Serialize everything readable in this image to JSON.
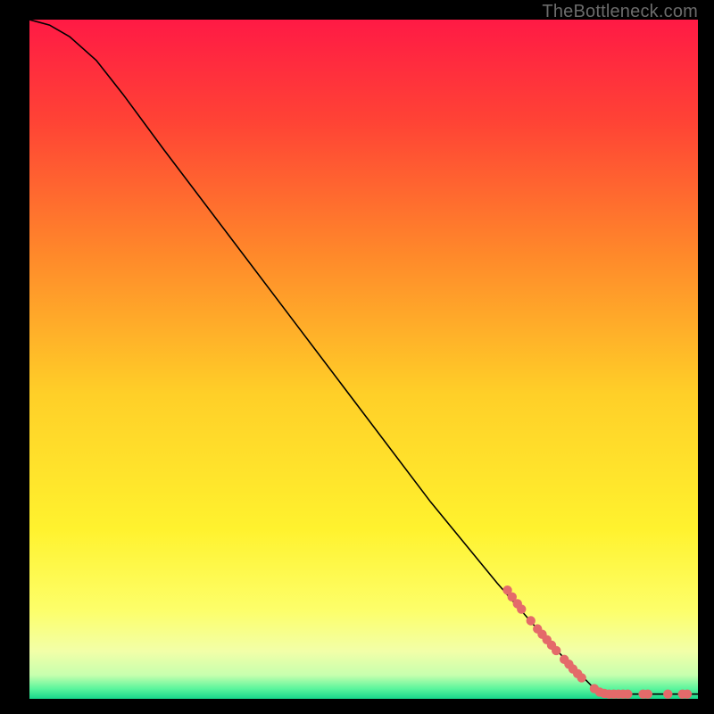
{
  "watermark": "TheBottleneck.com",
  "chart_data": {
    "type": "line",
    "title": "",
    "xlabel": "",
    "ylabel": "",
    "xlim": [
      0,
      100
    ],
    "ylim": [
      0,
      100
    ],
    "grid": false,
    "curve": [
      {
        "x": 0,
        "y": 100
      },
      {
        "x": 3,
        "y": 99.2
      },
      {
        "x": 6,
        "y": 97.5
      },
      {
        "x": 10,
        "y": 94
      },
      {
        "x": 14,
        "y": 89
      },
      {
        "x": 20,
        "y": 81
      },
      {
        "x": 30,
        "y": 68
      },
      {
        "x": 40,
        "y": 55
      },
      {
        "x": 50,
        "y": 42
      },
      {
        "x": 60,
        "y": 29
      },
      {
        "x": 70,
        "y": 17
      },
      {
        "x": 78,
        "y": 8
      },
      {
        "x": 84,
        "y": 2
      },
      {
        "x": 86,
        "y": 1
      },
      {
        "x": 88,
        "y": 0.7
      },
      {
        "x": 92,
        "y": 0.7
      },
      {
        "x": 96,
        "y": 0.7
      },
      {
        "x": 100,
        "y": 0.7
      }
    ],
    "markers": [
      {
        "x": 71.5,
        "y": 16.0
      },
      {
        "x": 72.2,
        "y": 15.0
      },
      {
        "x": 73.0,
        "y": 14.0
      },
      {
        "x": 73.6,
        "y": 13.2
      },
      {
        "x": 75.0,
        "y": 11.5
      },
      {
        "x": 76.0,
        "y": 10.3
      },
      {
        "x": 76.7,
        "y": 9.5
      },
      {
        "x": 77.4,
        "y": 8.7
      },
      {
        "x": 78.1,
        "y": 7.9
      },
      {
        "x": 78.8,
        "y": 7.1
      },
      {
        "x": 80.0,
        "y": 5.8
      },
      {
        "x": 80.7,
        "y": 5.1
      },
      {
        "x": 81.3,
        "y": 4.4
      },
      {
        "x": 82.0,
        "y": 3.7
      },
      {
        "x": 82.6,
        "y": 3.1
      },
      {
        "x": 84.5,
        "y": 1.5
      },
      {
        "x": 85.3,
        "y": 1.0
      },
      {
        "x": 86.0,
        "y": 0.8
      },
      {
        "x": 86.7,
        "y": 0.7
      },
      {
        "x": 87.4,
        "y": 0.7
      },
      {
        "x": 88.1,
        "y": 0.7
      },
      {
        "x": 88.8,
        "y": 0.7
      },
      {
        "x": 89.5,
        "y": 0.7
      },
      {
        "x": 91.8,
        "y": 0.7
      },
      {
        "x": 92.5,
        "y": 0.7
      },
      {
        "x": 95.5,
        "y": 0.7
      },
      {
        "x": 97.7,
        "y": 0.7
      },
      {
        "x": 98.4,
        "y": 0.7
      }
    ],
    "marker_color": "#e46a6a",
    "line_color": "#000000",
    "gradient_stops": [
      {
        "pos": 0.0,
        "color": "#ff1a45"
      },
      {
        "pos": 0.15,
        "color": "#ff4335"
      },
      {
        "pos": 0.35,
        "color": "#ff8a2a"
      },
      {
        "pos": 0.55,
        "color": "#ffcf28"
      },
      {
        "pos": 0.75,
        "color": "#fff22e"
      },
      {
        "pos": 0.87,
        "color": "#fdff6a"
      },
      {
        "pos": 0.93,
        "color": "#f2ffa8"
      },
      {
        "pos": 0.965,
        "color": "#c7ffae"
      },
      {
        "pos": 0.985,
        "color": "#5bf59d"
      },
      {
        "pos": 1.0,
        "color": "#17d68b"
      }
    ]
  }
}
